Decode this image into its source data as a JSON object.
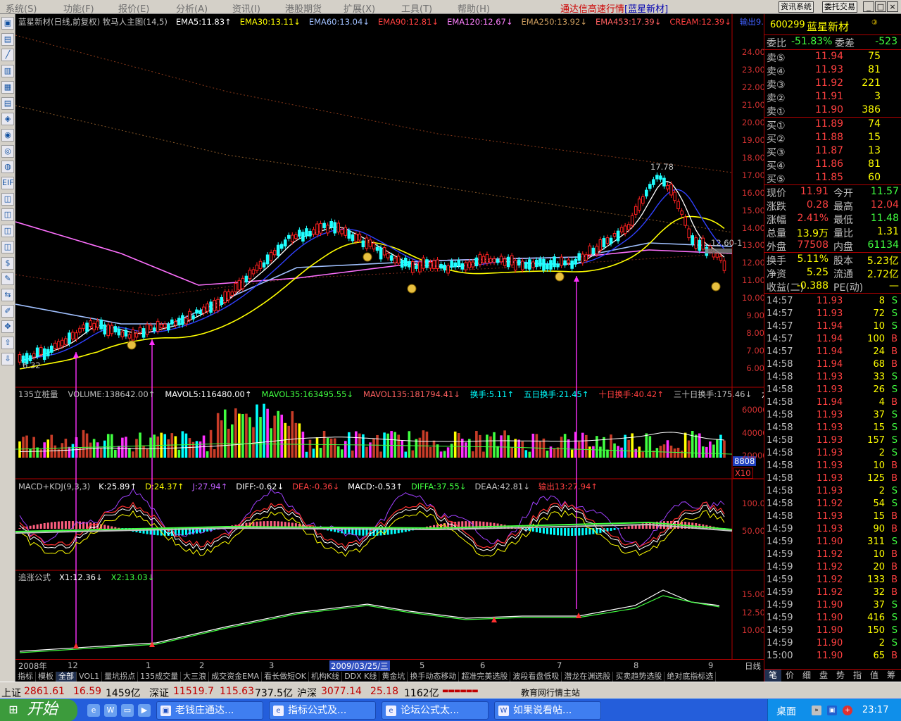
{
  "menubar": {
    "items": [
      "系统(S)",
      "功能(F)",
      "报价(E)",
      "分析(A)",
      "资讯(I)",
      "港股期货",
      "扩展(X)",
      "工具(T)",
      "帮助(H)"
    ],
    "app_title": "通达信高速行情",
    "stock_title": "[蓝星新材]",
    "buttons": [
      "资讯系统",
      "委托交易"
    ],
    "win_controls": [
      "_",
      "□",
      "×"
    ]
  },
  "left_toolbar": [
    "▣",
    "▤",
    "╱",
    "▥",
    "▦",
    "▤",
    "◈",
    "◉",
    "◎",
    "◍",
    "EIF",
    "◫",
    "◫",
    "◫",
    "◫",
    "$",
    "✎",
    "⇆",
    "✐",
    "✥",
    "⇧",
    "⇩"
  ],
  "main_chart": {
    "header": [
      {
        "text": "蓝星新材(日线,前复权) 牧马人主图(14,5)",
        "color": "#c0c0c0"
      },
      {
        "text": "EMA5:11.83↑",
        "color": "#ffffff"
      },
      {
        "text": "EMA30:13.11↓",
        "color": "#ffff00"
      },
      {
        "text": "EMA60:13.04↓",
        "color": "#a0c0ff"
      },
      {
        "text": "EMA90:12.81↓",
        "color": "#ff4040"
      },
      {
        "text": "EMA120:12.67↓",
        "color": "#ff80ff"
      },
      {
        "text": "EMA250:13.92↓",
        "color": "#d0a060"
      },
      {
        "text": "EMA453:17.39↓",
        "color": "#ff6060"
      },
      {
        "text": "CREAM:12.39↓",
        "color": "#ff4040"
      },
      {
        "text": "输出9.12",
        "color": "#4060ff"
      }
    ],
    "y_axis": [
      "24.00",
      "23.00",
      "22.00",
      "21.00",
      "20.00",
      "19.00",
      "18.00",
      "17.00",
      "16.00",
      "15.00",
      "14.00",
      "13.00",
      "12.00",
      "11.00",
      "10.00",
      "9.00",
      "8.00",
      "7.00",
      "6.00"
    ],
    "annotations": {
      "high": "17.78",
      "low": "6.32",
      "current": "12.60-1"
    }
  },
  "volume_panel": {
    "header": [
      {
        "text": "135立桩量",
        "color": "#c0c0c0"
      },
      {
        "text": "VOLUME:138642.00↑",
        "color": "#c0c0c0"
      },
      {
        "text": "MAVOL5:116480.00↑",
        "color": "#ffffff"
      },
      {
        "text": "MAVOL35:163495.55↓",
        "color": "#40ff40"
      },
      {
        "text": "MAVOL135:181794.41↓",
        "color": "#ff6060"
      },
      {
        "text": "换手:5.11↑",
        "color": "#00ffff"
      },
      {
        "text": "五日换手:21.45↑",
        "color": "#00ffff"
      },
      {
        "text": "十日换手:40.42↑",
        "color": "#ff4040"
      },
      {
        "text": "三十日换手:175.46↓",
        "color": "#c0c0c0"
      },
      {
        "text": "六十日",
        "color": "#ffffff"
      }
    ],
    "y_axis": [
      "60000",
      "40000",
      "20000"
    ],
    "current_box": "8808",
    "unit_box": "X10"
  },
  "macd_panel": {
    "header": [
      {
        "text": "MACD+KDJ(9,3,3)",
        "color": "#c0c0c0"
      },
      {
        "text": "K:25.89↑",
        "color": "#ffffff"
      },
      {
        "text": "D:24.37↑",
        "color": "#ffff00"
      },
      {
        "text": "J:27.94↑",
        "color": "#c060ff"
      },
      {
        "text": "DIFF:-0.62↓",
        "color": "#ffffff"
      },
      {
        "text": "DEA:-0.36↓",
        "color": "#ff4040"
      },
      {
        "text": "MACD:-0.53↑",
        "color": "#ffffff"
      },
      {
        "text": "DIFFA:37.55↓",
        "color": "#40ff40"
      },
      {
        "text": "DEAA:42.81↓",
        "color": "#c0c0c0"
      },
      {
        "text": "输出13:27.94↑",
        "color": "#ff4040"
      }
    ],
    "y_axis": [
      "100.0",
      "50.00"
    ]
  },
  "chase_panel": {
    "header": [
      {
        "text": "追涨公式",
        "color": "#c0c0c0"
      },
      {
        "text": "X1:12.36↓",
        "color": "#ffffff"
      },
      {
        "text": "X2:13.03↓",
        "color": "#40ff40"
      }
    ],
    "y_axis": [
      "15.00",
      "12.50",
      "10.00"
    ]
  },
  "date_axis": {
    "labels": [
      "2008年",
      "12",
      "1",
      "2",
      "3",
      "2009/03/25/三",
      "5",
      "6",
      "7",
      "8",
      "9"
    ],
    "period": "日线"
  },
  "indicator_tabs": [
    "指标",
    "模板",
    "全部",
    "VOL1",
    "量坑拐点",
    "135成交量",
    "大三浪",
    "成交资金EMA",
    "看长做短OK",
    "机构K线",
    "DDX K线",
    "黄金坑",
    "换手动态移动",
    "超准完美选股",
    "波段看盘低吸",
    "潜龙在渊选股",
    "买卖趋势选股",
    "绝对底指标选"
  ],
  "quote": {
    "code": "600299",
    "name": "蓝星新材",
    "flag": "③",
    "webi_label": "委比",
    "webi_value": "-51.83%",
    "wecha_label": "委差",
    "wecha_value": "-523",
    "asks": [
      {
        "label": "卖⑤",
        "price": "11.94",
        "vol": "75"
      },
      {
        "label": "卖④",
        "price": "11.93",
        "vol": "81"
      },
      {
        "label": "卖③",
        "price": "11.92",
        "vol": "221"
      },
      {
        "label": "卖②",
        "price": "11.91",
        "vol": "3"
      },
      {
        "label": "卖①",
        "price": "11.90",
        "vol": "386"
      }
    ],
    "bids": [
      {
        "label": "买①",
        "price": "11.89",
        "vol": "74"
      },
      {
        "label": "买②",
        "price": "11.88",
        "vol": "15"
      },
      {
        "label": "买③",
        "price": "11.87",
        "vol": "13"
      },
      {
        "label": "买④",
        "price": "11.86",
        "vol": "81"
      },
      {
        "label": "买⑤",
        "price": "11.85",
        "vol": "60"
      }
    ],
    "stats": [
      {
        "l1": "现价",
        "v1": "11.91",
        "c1": "#ff4040",
        "l2": "今开",
        "v2": "11.57",
        "c2": "#40ff40"
      },
      {
        "l1": "涨跌",
        "v1": "0.28",
        "c1": "#ff4040",
        "l2": "最高",
        "v2": "12.04",
        "c2": "#ff4040"
      },
      {
        "l1": "涨幅",
        "v1": "2.41%",
        "c1": "#ff4040",
        "l2": "最低",
        "v2": "11.48",
        "c2": "#40ff40"
      },
      {
        "l1": "总量",
        "v1": "13.9万",
        "c1": "#ffff00",
        "l2": "量比",
        "v2": "1.31",
        "c2": "#ffff00"
      },
      {
        "l1": "外盘",
        "v1": "77508",
        "c1": "#ff4040",
        "l2": "内盘",
        "v2": "61134",
        "c2": "#40ff40"
      }
    ],
    "stats2": [
      {
        "l1": "换手",
        "v1": "5.11%",
        "l2": "股本",
        "v2": "5.23亿"
      },
      {
        "l1": "净资",
        "v1": "5.25",
        "l2": "流通",
        "v2": "2.72亿"
      },
      {
        "l1": "收益(二)",
        "v1": "-0.388",
        "l2": "PE(动)",
        "v2": "—"
      }
    ]
  },
  "ticks": [
    {
      "time": "14:57",
      "price": "11.93",
      "vol": "8",
      "side": "S"
    },
    {
      "time": "14:57",
      "price": "11.93",
      "vol": "72",
      "side": "S"
    },
    {
      "time": "14:57",
      "price": "11.94",
      "vol": "10",
      "side": "S"
    },
    {
      "time": "14:57",
      "price": "11.94",
      "vol": "100",
      "side": "B"
    },
    {
      "time": "14:57",
      "price": "11.94",
      "vol": "24",
      "side": "B"
    },
    {
      "time": "14:58",
      "price": "11.94",
      "vol": "68",
      "side": "B"
    },
    {
      "time": "14:58",
      "price": "11.93",
      "vol": "33",
      "side": "S"
    },
    {
      "time": "14:58",
      "price": "11.93",
      "vol": "26",
      "side": "S"
    },
    {
      "time": "14:58",
      "price": "11.94",
      "vol": "4",
      "side": "B"
    },
    {
      "time": "14:58",
      "price": "11.93",
      "vol": "37",
      "side": "S"
    },
    {
      "time": "14:58",
      "price": "11.93",
      "vol": "15",
      "side": "S"
    },
    {
      "time": "14:58",
      "price": "11.93",
      "vol": "157",
      "side": "S"
    },
    {
      "time": "14:58",
      "price": "11.93",
      "vol": "2",
      "side": "S"
    },
    {
      "time": "14:58",
      "price": "11.93",
      "vol": "10",
      "side": "B"
    },
    {
      "time": "14:58",
      "price": "11.93",
      "vol": "125",
      "side": "B"
    },
    {
      "time": "14:58",
      "price": "11.93",
      "vol": "2",
      "side": "S"
    },
    {
      "time": "14:58",
      "price": "11.92",
      "vol": "54",
      "side": "S"
    },
    {
      "time": "14:58",
      "price": "11.93",
      "vol": "15",
      "side": "B"
    },
    {
      "time": "14:59",
      "price": "11.93",
      "vol": "90",
      "side": "B"
    },
    {
      "time": "14:59",
      "price": "11.90",
      "vol": "311",
      "side": "S"
    },
    {
      "time": "14:59",
      "price": "11.92",
      "vol": "10",
      "side": "B"
    },
    {
      "time": "14:59",
      "price": "11.92",
      "vol": "20",
      "side": "B"
    },
    {
      "time": "14:59",
      "price": "11.92",
      "vol": "133",
      "side": "B"
    },
    {
      "time": "14:59",
      "price": "11.92",
      "vol": "32",
      "side": "B"
    },
    {
      "time": "14:59",
      "price": "11.90",
      "vol": "37",
      "side": "S"
    },
    {
      "time": "14:59",
      "price": "11.90",
      "vol": "416",
      "side": "S"
    },
    {
      "time": "14:59",
      "price": "11.90",
      "vol": "150",
      "side": "S"
    },
    {
      "time": "14:59",
      "price": "11.90",
      "vol": "2",
      "side": "S"
    },
    {
      "time": "15:00",
      "price": "11.90",
      "vol": "65",
      "side": "B"
    }
  ],
  "right_tabs": [
    "笔",
    "价",
    "细",
    "盘",
    "势",
    "指",
    "值",
    "筹"
  ],
  "status_bar": {
    "sh_label": "上证",
    "sh_index": "2861.61",
    "sh_change": "16.59",
    "sh_amount": "1459亿",
    "sz_label": "深证",
    "sz_index": "11519.7",
    "sz_change": "115.63",
    "sz_amount": "737.5亿",
    "hs_label": "沪深",
    "hs_index": "3077.14",
    "hs_change": "25.18",
    "hs_amount": "1162亿",
    "site": "教育网行情主站"
  },
  "taskbar": {
    "start": "开始",
    "windows": [
      "老钱庄通达...",
      "指标公式及...",
      "论坛公式太...",
      "如果说看帖..."
    ],
    "desktop": "桌面",
    "clock": "23:17"
  },
  "colors": {
    "up": "#ff4040",
    "down": "#40ff40",
    "grid": "#b00000",
    "panel_bg": "#000000"
  }
}
